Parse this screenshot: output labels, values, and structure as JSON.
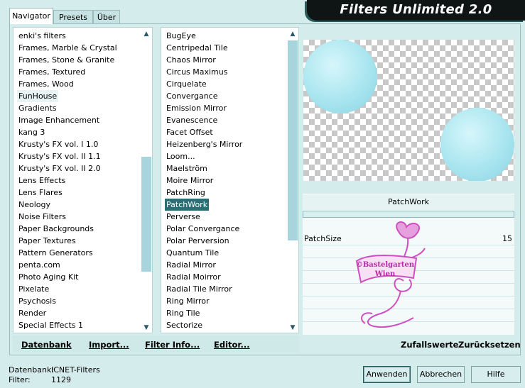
{
  "tabs": [
    {
      "label": "Navigator",
      "active": true
    },
    {
      "label": "Presets",
      "active": false
    },
    {
      "label": "Über",
      "active": false
    }
  ],
  "title": "Filters Unlimited 2.0",
  "categories": {
    "highlighted": "FunHouse",
    "items": [
      "enki's filters",
      "Frames, Marble & Crystal",
      "Frames, Stone & Granite",
      "Frames, Textured",
      "Frames, Wood",
      "FunHouse",
      "Gradients",
      "Image Enhancement",
      "kang 3",
      "Krusty's FX vol. I 1.0",
      "Krusty's FX vol. II 1.1",
      "Krusty's FX vol. II 2.0",
      "Lens Effects",
      "Lens Flares",
      "Neology",
      "Noise Filters",
      "Paper Backgrounds",
      "Paper Textures",
      "Pattern Generators",
      "penta.com",
      "Photo Aging Kit",
      "Pixelate",
      "Psychosis",
      "Render",
      "Special Effects 1"
    ]
  },
  "filters": {
    "selected": "PatchWork",
    "items": [
      "BugEye",
      "Centripedal Tile",
      "Chaos Mirror",
      "Circus Maximus",
      "Cirquelate",
      "Convergance",
      "Emission Mirror",
      "Evanescence",
      "Facet Offset",
      "Heizenberg's Mirror",
      "Loom...",
      "Maelström",
      "Moire Mirror",
      "PatchRing",
      "PatchWork",
      "Perverse",
      "Polar Convergance",
      "Polar Perversion",
      "Quantum Tile",
      "Radial Mirror",
      "Radial Moirror",
      "Radial Tile Mirror",
      "Ring Mirror",
      "Ring Tile",
      "Sectorize"
    ]
  },
  "bottom_links": {
    "database": "Datenbank",
    "import": "Import...",
    "filter_info": "Filter Info...",
    "editor": "Editor..."
  },
  "settings": {
    "filter_name": "PatchWork",
    "params": [
      {
        "name": "PatchSize",
        "value": "15"
      }
    ],
    "random_label": "Zufallswerte",
    "reset_label": "Zurücksetzen"
  },
  "watermark": {
    "line1": "©Bastelgarten",
    "line2": "Wien"
  },
  "footer": {
    "db_label": "Datenbank:",
    "db_value": "ICNET-Filters",
    "filter_label": "Filter:",
    "filter_value": "1129"
  },
  "buttons": {
    "apply": "Anwenden",
    "cancel": "Abbrechen",
    "help": "Hilfe"
  },
  "colors": {
    "background": "#d4ecec",
    "selection": "#2d6e74",
    "scroll_thumb": "#a8d5dd",
    "title_banner": "#0f1414"
  }
}
